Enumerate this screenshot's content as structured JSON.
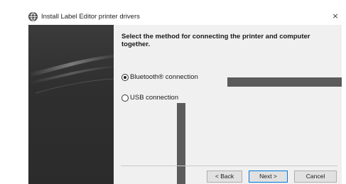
{
  "window": {
    "title": "Install Label Editor printer drivers",
    "close_glyph": "×"
  },
  "content": {
    "heading": "Select the method for connecting the printer and computer together.",
    "options": [
      {
        "label": "Bluetooth® connection",
        "selected": true
      },
      {
        "label": "USB connection",
        "selected": false
      }
    ]
  },
  "buttons": {
    "back": "< Back",
    "next": "Next >",
    "cancel": "Cancel"
  },
  "icons": {
    "app": "brother-globe-icon",
    "close": "close-icon"
  },
  "colors": {
    "banner": "#2f2f2f",
    "panel": "#f0f0f0",
    "callout": "#5b5b5b",
    "accent": "#0078d7"
  }
}
